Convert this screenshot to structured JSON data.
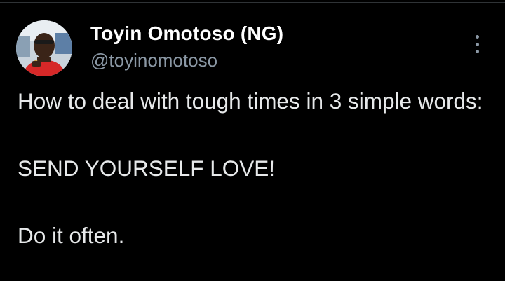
{
  "author": {
    "display_name": "Toyin Omotoso (NG)",
    "handle": "@toyinomotoso",
    "avatar_icon": "user-avatar-photo"
  },
  "menu": {
    "icon": "more-vertical-icon"
  },
  "tweet": {
    "line1": "How to deal with tough times in 3 simple words:",
    "line2": "SEND YOURSELF LOVE!",
    "line3": "Do it often."
  },
  "colors": {
    "background": "#000000",
    "text": "#e7e9ea",
    "secondary_text": "#8b98a5"
  }
}
